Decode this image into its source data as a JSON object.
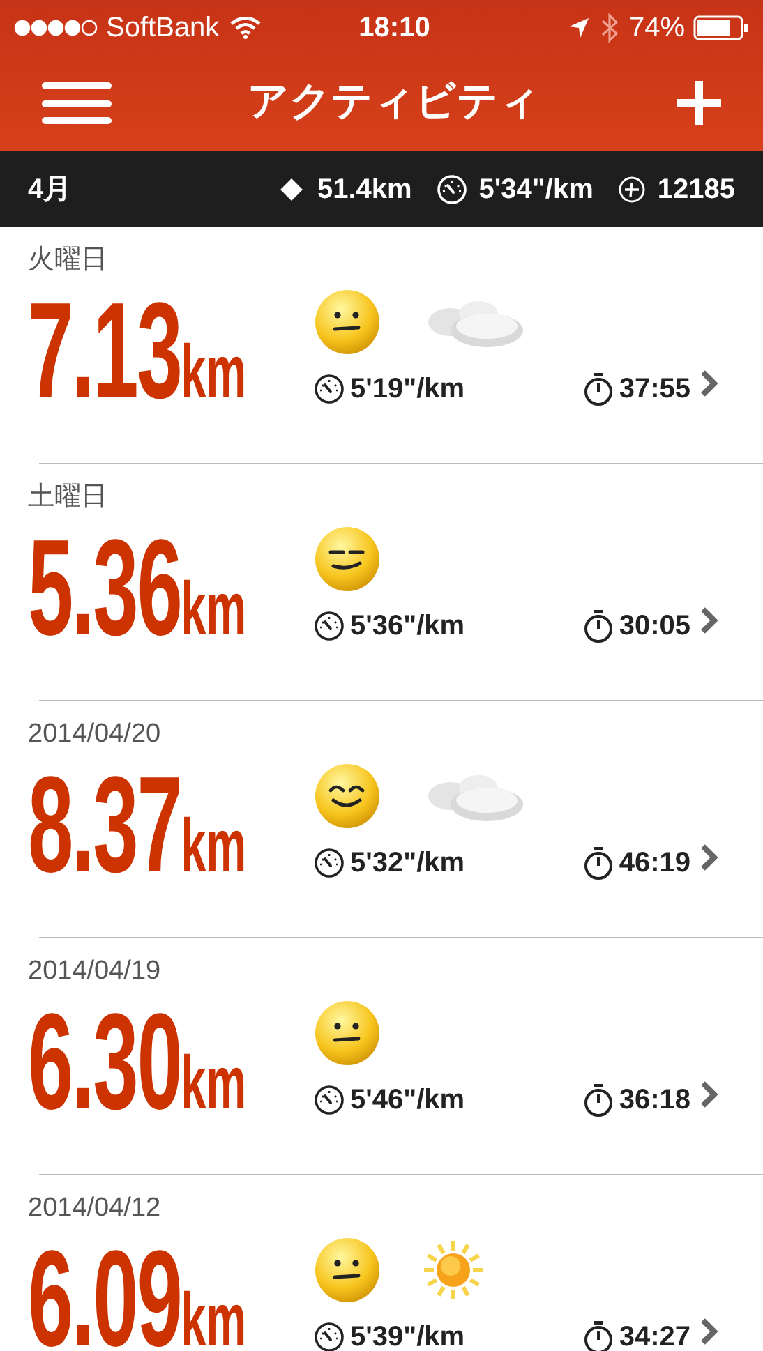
{
  "status_bar": {
    "carrier": "SoftBank",
    "time": "18:10",
    "battery": "74%"
  },
  "nav": {
    "title": "アクティビティ"
  },
  "summary": {
    "month": "4月",
    "distance": "51.4km",
    "pace": "5'34\"/km",
    "fuel": "12185"
  },
  "activities": [
    {
      "date": "火曜日",
      "distance": "7.13",
      "unit": "km",
      "icons": [
        {
          "kind": "neutral"
        },
        {
          "kind": "cloudy"
        }
      ],
      "pace": "5'19\"/km",
      "duration": "37:55"
    },
    {
      "date": "土曜日",
      "distance": "5.36",
      "unit": "km",
      "icons": [
        {
          "kind": "smirk"
        }
      ],
      "pace": "5'36\"/km",
      "duration": "30:05"
    },
    {
      "date": "2014/04/20",
      "distance": "8.37",
      "unit": "km",
      "icons": [
        {
          "kind": "smile"
        },
        {
          "kind": "cloudy"
        }
      ],
      "pace": "5'32\"/km",
      "duration": "46:19"
    },
    {
      "date": "2014/04/19",
      "distance": "6.30",
      "unit": "km",
      "icons": [
        {
          "kind": "neutral"
        }
      ],
      "pace": "5'46\"/km",
      "duration": "36:18"
    },
    {
      "date": "2014/04/12",
      "distance": "6.09",
      "unit": "km",
      "icons": [
        {
          "kind": "neutral"
        },
        {
          "kind": "sunny"
        }
      ],
      "pace": "5'39\"/km",
      "duration": "34:27"
    }
  ]
}
